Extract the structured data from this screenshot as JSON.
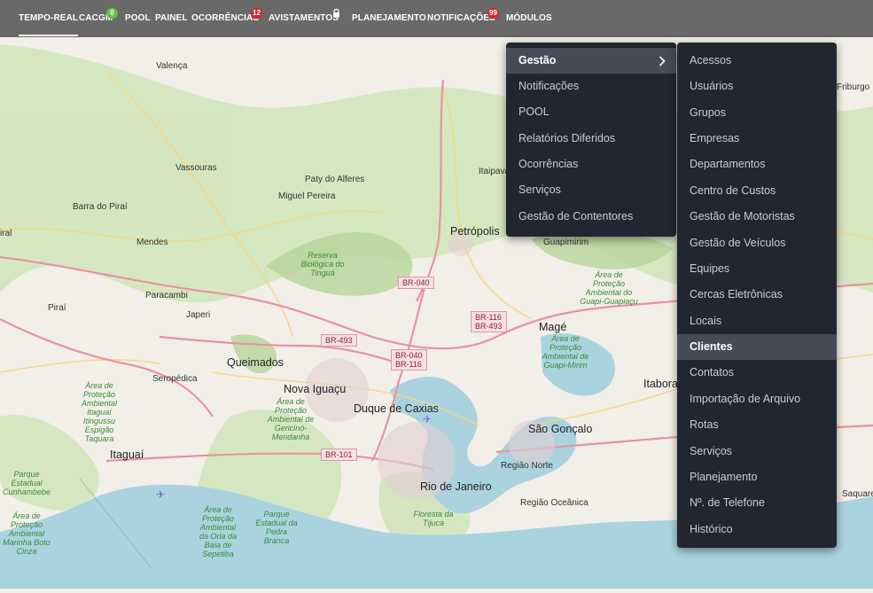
{
  "nav": {
    "items": [
      {
        "label": "TEMPO-REAL",
        "active": true
      },
      {
        "label": "CACGM",
        "badge": "0",
        "badge_color": "#6dbb4b"
      },
      {
        "label": "POOL"
      },
      {
        "label": "PAINEL"
      },
      {
        "label": "OCORRÊNCIAS",
        "badge": "12",
        "badge_color": "#d9262e"
      },
      {
        "label": "AVISTAMENTOS",
        "icon": "lock-icon"
      },
      {
        "label": "PLANEJAMENTO"
      },
      {
        "label": "NOTIFICAÇÕES",
        "badge": "99",
        "badge_color": "#d9262e"
      },
      {
        "label": "MÓDULOS"
      }
    ]
  },
  "modules_menu": {
    "items": [
      "Gestão",
      "Notificações",
      "POOL",
      "Relatórios Diferidos",
      "Ocorrências",
      "Serviços",
      "Gestão de Contentores"
    ],
    "highlighted": "Gestão"
  },
  "gestao_submenu": {
    "items": [
      "Acessos",
      "Usuários",
      "Grupos",
      "Empresas",
      "Departamentos",
      "Centro de Custos",
      "Gestão de Motoristas",
      "Gestão de Veículos",
      "Equipes",
      "Cercas Eletrônicas",
      "Locais",
      "Clientes",
      "Contatos",
      "Importação de Arquivo",
      "Rotas",
      "Serviços",
      "Planejamento",
      "Nº. de Telefone",
      "Histórico"
    ],
    "highlighted": "Clientes"
  },
  "map": {
    "cities": [
      "Valença",
      "Vassouras",
      "Paty do Alferes",
      "Miguel Pereira",
      "Barra do Piraí",
      "Mendes",
      "Petrópolis",
      "Itaipava",
      "Guapimirim",
      "Paracambi",
      "Japeri",
      "Piraí",
      "Magé",
      "Queimados",
      "Seropédica",
      "Nova Iguaçu",
      "Duque de Caxias",
      "Itaboraí",
      "São Gonçalo",
      "Itaguaí",
      "Região Norte",
      "Rio de Janeiro",
      "Região Oceânica",
      "Saquarema",
      "Friburgo",
      "iral"
    ],
    "parks": [
      "Reserva Biológica do Tinguá",
      "Área de Proteção Ambiental do Guapi-Guapiaçu",
      "Área de Proteção Ambiental de Guapi-Mirim",
      "Área de Proteção Ambiental Itaguaí Itingussu Espigão Taquara",
      "Área de Proteção Ambiental de Gericinó-Mendanha",
      "Parque Estadual Cunhambebe",
      "Área de Proteção Ambiental Marinha Boto Cinza",
      "Área de Proteção Ambiental da Orla da Baía de Sepetiba",
      "Parque Estadual da Pedra Branca",
      "Floresta da Tijuca"
    ],
    "roads": [
      "BR-040",
      "BR-116",
      "BR-493",
      "BR-101"
    ]
  },
  "colors": {
    "topbar": "#5f5f5f",
    "menu_bg": "#222630",
    "menu_highlight": "#474b57",
    "water": "#aad3df",
    "forest": "#c8dfb0",
    "motorway": "#e892a2",
    "road": "#f7d57e"
  }
}
